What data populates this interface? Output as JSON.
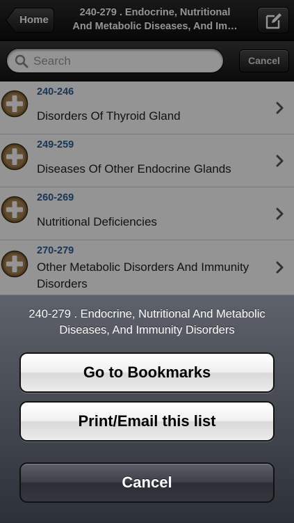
{
  "navbar": {
    "back_label": "Home",
    "title_line1": "240-279 . Endocrine, Nutritional",
    "title_line2": "And Metabolic Diseases, And Im…"
  },
  "search": {
    "placeholder": "Search",
    "cancel_label": "Cancel"
  },
  "list": {
    "items": [
      {
        "code": "240-246",
        "name": "Disorders Of Thyroid Gland"
      },
      {
        "code": "249-259",
        "name": "Diseases Of Other Endocrine Glands"
      },
      {
        "code": "260-269",
        "name": "Nutritional Deficiencies"
      },
      {
        "code": "270-279",
        "name": "Other Metabolic Disorders And Immunity Disorders"
      }
    ]
  },
  "action_sheet": {
    "title": "240-279 . Endocrine, Nutritional And Metabolic Diseases, And Immunity Disorders",
    "bookmarks_label": "Go to Bookmarks",
    "print_label": "Print/Email this list",
    "cancel_label": "Cancel"
  },
  "colors": {
    "code_text": "#2a5f93",
    "plus_icon": "#8a6a3a"
  },
  "icons": [
    "back-arrow",
    "compose-icon",
    "search-icon",
    "plus-icon",
    "chevron-right-icon"
  ]
}
